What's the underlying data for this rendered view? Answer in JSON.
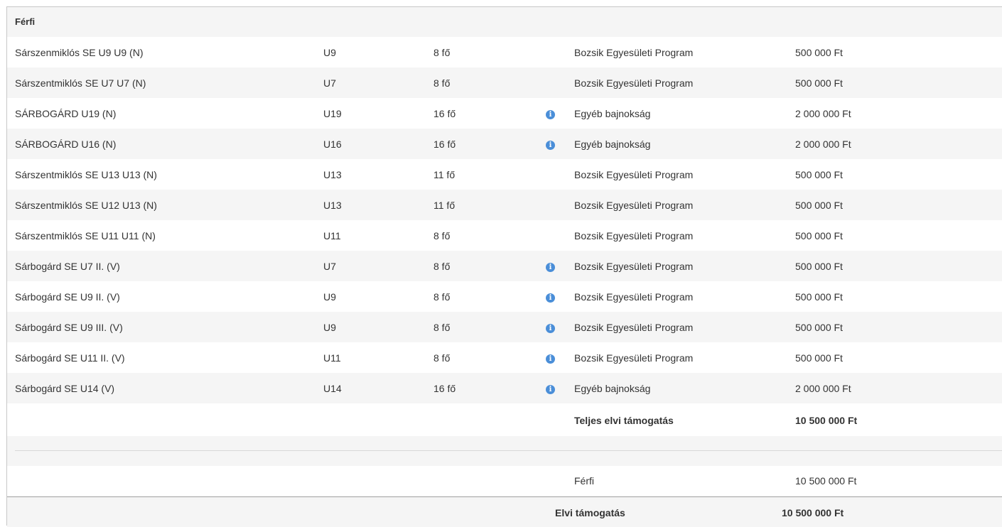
{
  "section": {
    "title": "Férfi"
  },
  "teams": [
    {
      "name": "Sárszenmiklós SE U9 U9 (N)",
      "age": "U9",
      "size": "8 fő",
      "info": false,
      "program": "Bozsik Egyesületi Program",
      "amount": "500 000 Ft"
    },
    {
      "name": "Sárszentmiklós SE U7 U7 (N)",
      "age": "U7",
      "size": "8 fő",
      "info": false,
      "program": "Bozsik Egyesületi Program",
      "amount": "500 000 Ft"
    },
    {
      "name": "SÁRBOGÁRD U19 (N)",
      "age": "U19",
      "size": "16 fő",
      "info": true,
      "program": "Egyéb bajnokság",
      "amount": "2 000 000 Ft"
    },
    {
      "name": "SÁRBOGÁRD U16 (N)",
      "age": "U16",
      "size": "16 fő",
      "info": true,
      "program": "Egyéb bajnokság",
      "amount": "2 000 000 Ft"
    },
    {
      "name": "Sárszentmiklós SE U13 U13 (N)",
      "age": "U13",
      "size": "11 fő",
      "info": false,
      "program": "Bozsik Egyesületi Program",
      "amount": "500 000 Ft"
    },
    {
      "name": "Sárszentmiklós SE U12 U13 (N)",
      "age": "U13",
      "size": "11 fő",
      "info": false,
      "program": "Bozsik Egyesületi Program",
      "amount": "500 000 Ft"
    },
    {
      "name": "Sárszentmiklós SE U11 U11 (N)",
      "age": "U11",
      "size": "8 fő",
      "info": false,
      "program": "Bozsik Egyesületi Program",
      "amount": "500 000 Ft"
    },
    {
      "name": "Sárbogárd SE U7 II. (V)",
      "age": "U7",
      "size": "8 fő",
      "info": true,
      "program": "Bozsik Egyesületi Program",
      "amount": "500 000 Ft"
    },
    {
      "name": "Sárbogárd SE U9 II. (V)",
      "age": "U9",
      "size": "8 fő",
      "info": true,
      "program": "Bozsik Egyesületi Program",
      "amount": "500 000 Ft"
    },
    {
      "name": "Sárbogárd SE U9 III. (V)",
      "age": "U9",
      "size": "8 fő",
      "info": true,
      "program": "Bozsik Egyesületi Program",
      "amount": "500 000 Ft"
    },
    {
      "name": "Sárbogárd SE U11 II. (V)",
      "age": "U11",
      "size": "8 fő",
      "info": true,
      "program": "Bozsik Egyesületi Program",
      "amount": "500 000 Ft"
    },
    {
      "name": "Sárbogárd SE U14 (V)",
      "age": "U14",
      "size": "16 fő",
      "info": true,
      "program": "Egyéb bajnokság",
      "amount": "2 000 000 Ft"
    }
  ],
  "total": {
    "label": "Teljes elvi támogatás",
    "amount": "10 500 000 Ft"
  },
  "summary": {
    "label": "Férfi",
    "amount": "10 500 000 Ft"
  },
  "footer": {
    "label": "Elvi támogatás",
    "amount": "10 500 000 Ft"
  },
  "info_icon": {
    "name": "info-icon",
    "glyph": "i",
    "color": "#4a8ed8"
  }
}
